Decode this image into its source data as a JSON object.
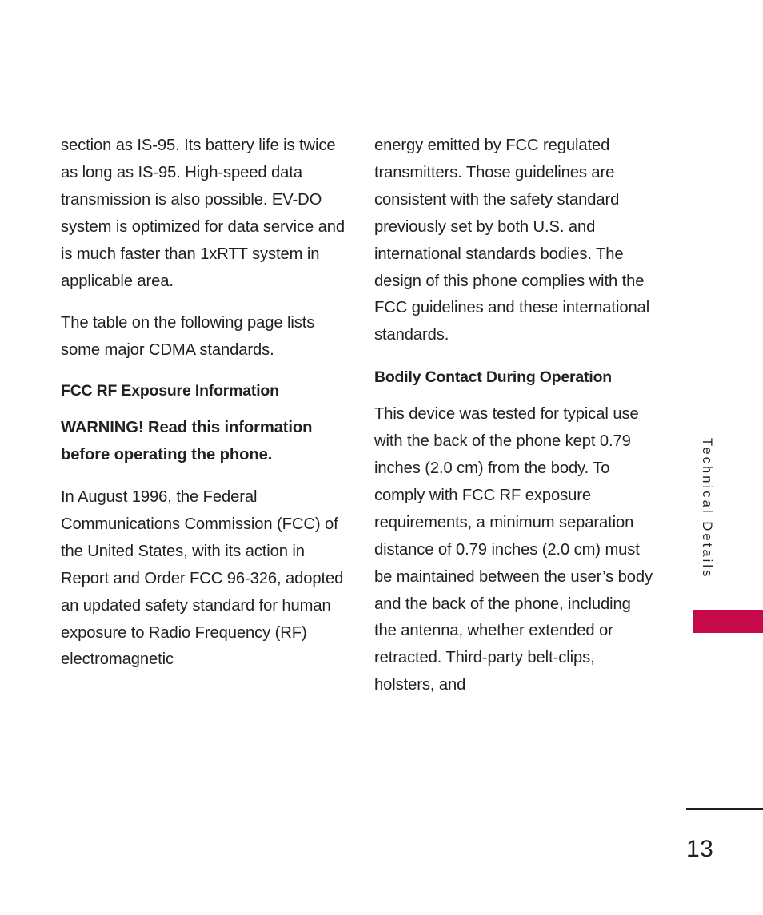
{
  "page": {
    "number": "13",
    "accent_color": "#c5094b",
    "text_color": "#231f20",
    "background_color": "#ffffff"
  },
  "side_tab": {
    "label": "Technical Details"
  },
  "columns": {
    "left": [
      {
        "type": "paragraph",
        "name": "paragraph-evdo",
        "text": "section as IS-95. Its battery life is twice as long as IS-95. High-speed data transmission is also possible. EV-DO system is optimized for data service and is much faster than 1xRTT system in applicable area."
      },
      {
        "type": "paragraph",
        "name": "paragraph-cdma-table",
        "text": "The table on the following page lists some major CDMA standards."
      },
      {
        "type": "heading",
        "name": "heading-fcc-rf-exposure",
        "text": "FCC RF Exposure Information"
      },
      {
        "type": "warning",
        "name": "paragraph-warning",
        "text": "WARNING! Read this information before operating the phone."
      },
      {
        "type": "paragraph",
        "name": "paragraph-august-1996",
        "text": "In August 1996, the Federal Communications Commission (FCC) of the United States, with its action in Report and Order FCC 96-326, adopted an updated safety standard for human exposure to Radio Frequency (RF) electromagnetic"
      }
    ],
    "right": [
      {
        "type": "paragraph",
        "name": "paragraph-energy-guidelines",
        "text": "energy emitted by FCC regulated transmitters. Those guidelines are consistent with the safety standard previously set by both U.S. and international standards bodies. The design of this phone complies with the FCC guidelines and these international standards."
      },
      {
        "type": "heading",
        "name": "heading-bodily-contact",
        "text": "Bodily Contact During Operation"
      },
      {
        "type": "paragraph",
        "name": "paragraph-device-tested",
        "text": "This device was tested for typical use with the back of the phone kept 0.79 inches (2.0 cm) from the body. To comply with FCC RF exposure requirements, a minimum separation distance of 0.79 inches (2.0 cm) must be maintained between the user’s body and the back of the phone, including the antenna, whether extended or retracted. Third-party belt-clips, holsters, and"
      }
    ]
  }
}
